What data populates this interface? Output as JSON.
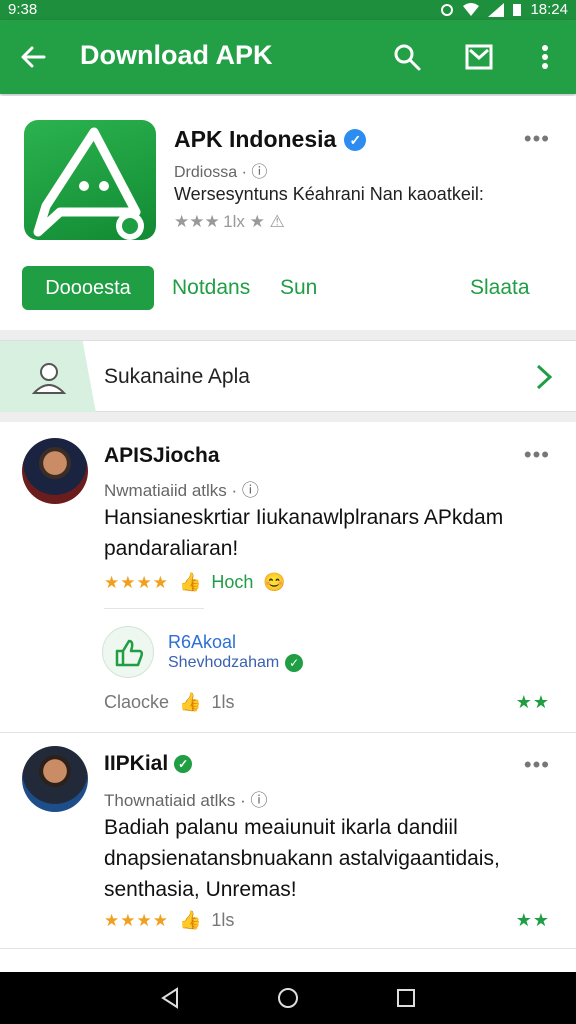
{
  "status_bar": {
    "time": "9:38",
    "clock_right": "18:24"
  },
  "app_bar": {
    "title": "Download APK"
  },
  "app": {
    "name": "APK Indonesia",
    "developer": "Drdiossa",
    "description": "Wersesyntuns Kéahrani Nan kaoatkeil:",
    "rating_text": "★★★ 1lx ★ ⚠",
    "primary_button": "Doooesta",
    "secondary_1": "Notdans",
    "secondary_2": "Sun",
    "secondary_3": "Slaata"
  },
  "suggestion": {
    "label": "Sukanaine Apla"
  },
  "reviews": [
    {
      "name": "APISJiocha",
      "meta": "Nwmatiaiid atlks",
      "body": "Hansianeskrtiar Iiukanawlplranars APkdam pandaraliaran!",
      "stars": "★★★★",
      "helpful": "Hoch",
      "reply_title": "R6Akoal",
      "reply_sub": "Shevhodzaham",
      "footer_label": "Claocke",
      "footer_count": "1ls",
      "green_stars": "★★"
    },
    {
      "name": "IIPKial",
      "meta": "Thownatiaid atlks",
      "body": "Badiah palanu meaiunuit ikarla dandiil dnapsienatansbnuakann astalvigaantidais, senthasia, Unremas!",
      "stars": "★★★★",
      "footer_count": "1ls",
      "green_stars": "★★"
    }
  ]
}
